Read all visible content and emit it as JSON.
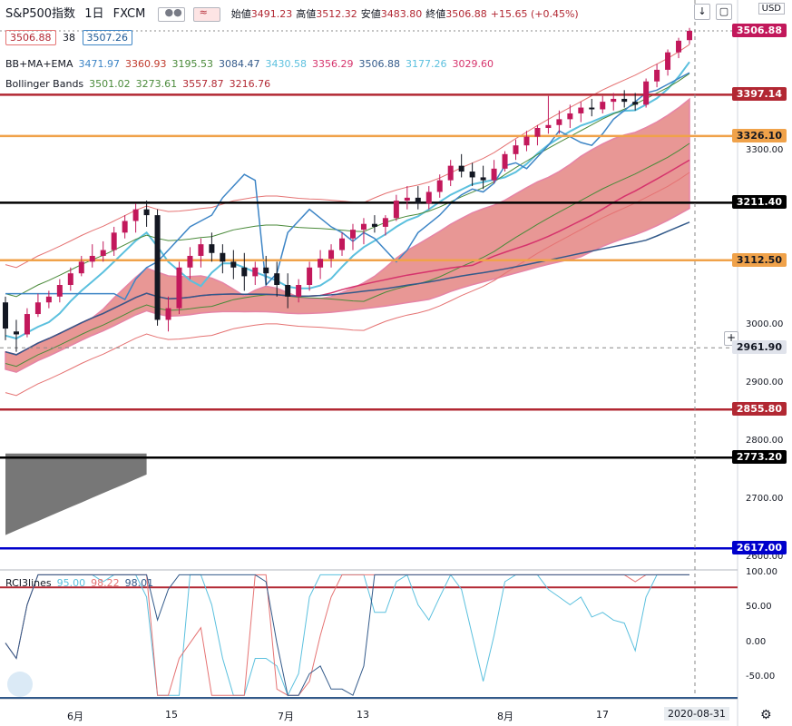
{
  "header": {
    "symbol": "S&P500指数",
    "interval": "1日",
    "source": "FXCM",
    "ohlc": [
      {
        "label": "始値",
        "value": "3491.23"
      },
      {
        "label": "高値",
        "value": "3512.32"
      },
      {
        "label": "安値",
        "value": "3483.80"
      },
      {
        "label": "終値",
        "value": "3506.88"
      }
    ],
    "change": "+15.65 (+0.45%)",
    "bid": "3506.88",
    "spread": "38",
    "ask": "3507.26"
  },
  "indicators": {
    "bbmaema": {
      "label": "BB+MA+EMA",
      "values": [
        {
          "v": "3471.97",
          "color": "#3d85c6"
        },
        {
          "v": "3360.93",
          "color": "#c0392b"
        },
        {
          "v": "3195.53",
          "color": "#4a8a3a"
        },
        {
          "v": "3084.47",
          "color": "#335a8a"
        },
        {
          "v": "3430.58",
          "color": "#5bc0de"
        },
        {
          "v": "3356.29",
          "color": "#d6336c"
        },
        {
          "v": "3506.88",
          "color": "#335a8a"
        },
        {
          "v": "3177.26",
          "color": "#5bc0de"
        },
        {
          "v": "3029.60",
          "color": "#d6336c"
        }
      ]
    },
    "bollinger": {
      "label": "Bollinger Bands",
      "values": [
        {
          "v": "3501.02",
          "color": "#4a8a3a"
        },
        {
          "v": "3273.61",
          "color": "#4a8a3a"
        },
        {
          "v": "3557.87",
          "color": "#b22833"
        },
        {
          "v": "3216.76",
          "color": "#b22833"
        }
      ]
    },
    "rci": {
      "label": "RCI3lines",
      "values": [
        {
          "v": "95.00",
          "color": "#5bc0de"
        },
        {
          "v": "98.22",
          "color": "#e57373"
        },
        {
          "v": "98.01",
          "color": "#335a8a"
        }
      ]
    }
  },
  "price_axis": {
    "currency": "USD",
    "ticks": [
      "3300.00",
      "3000.00",
      "2900.00",
      "2800.00",
      "2700.00",
      "2600.00"
    ],
    "tags": [
      {
        "value": "3506.88",
        "color": "#c2185b",
        "text_color": "#ffffff"
      },
      {
        "value": "3397.14",
        "color": "#b22833",
        "text_color": "#ffffff"
      },
      {
        "value": "3326.10",
        "color": "#f0a24a",
        "text_color": "#131722"
      },
      {
        "value": "3211.40",
        "color": "#000000",
        "text_color": "#ffffff"
      },
      {
        "value": "3112.50",
        "color": "#f0a24a",
        "text_color": "#131722"
      },
      {
        "value": "2961.90",
        "color": "#e0e3eb",
        "text_color": "#131722"
      },
      {
        "value": "2855.80",
        "color": "#b22833",
        "text_color": "#ffffff"
      },
      {
        "value": "2773.20",
        "color": "#000000",
        "text_color": "#ffffff"
      },
      {
        "value": "2617.00",
        "color": "#0000cc",
        "text_color": "#ffffff"
      }
    ]
  },
  "horizontal_lines": [
    {
      "value": 3397.14,
      "color": "#b22833"
    },
    {
      "value": 3326.1,
      "color": "#f0a24a"
    },
    {
      "value": 3211.4,
      "color": "#000000"
    },
    {
      "value": 3112.5,
      "color": "#f0a24a"
    },
    {
      "value": 2855.8,
      "color": "#b22833"
    },
    {
      "value": 2773.2,
      "color": "#000000"
    },
    {
      "value": 2617.0,
      "color": "#0000cc"
    }
  ],
  "rci_axis": {
    "ticks": [
      "100.00",
      "50.00",
      "0.00",
      "-50.00"
    ]
  },
  "time_axis": {
    "labels": [
      "6月",
      "15",
      "7月",
      "13",
      "8月",
      "17"
    ],
    "cursor_date": "2020-08-31"
  },
  "chart_data": {
    "type": "candlestick",
    "series": [
      {
        "name": "S&P500指数",
        "ohlc": [
          [
            3040,
            3050,
            2975,
            2995
          ],
          [
            2990,
            3010,
            2955,
            2985
          ],
          [
            2985,
            3030,
            2980,
            3020
          ],
          [
            3020,
            3055,
            3015,
            3040
          ],
          [
            3040,
            3060,
            3030,
            3050
          ],
          [
            3050,
            3080,
            3040,
            3070
          ],
          [
            3070,
            3100,
            3060,
            3090
          ],
          [
            3090,
            3120,
            3085,
            3110
          ],
          [
            3110,
            3140,
            3100,
            3120
          ],
          [
            3120,
            3145,
            3110,
            3130
          ],
          [
            3130,
            3170,
            3120,
            3160
          ],
          [
            3160,
            3190,
            3150,
            3180
          ],
          [
            3180,
            3210,
            3160,
            3200
          ],
          [
            3200,
            3215,
            3170,
            3190
          ],
          [
            3190,
            3200,
            3000,
            3010
          ],
          [
            3010,
            3050,
            2990,
            3030
          ],
          [
            3030,
            3110,
            3020,
            3100
          ],
          [
            3100,
            3135,
            3080,
            3120
          ],
          [
            3120,
            3150,
            3100,
            3140
          ],
          [
            3140,
            3160,
            3110,
            3125
          ],
          [
            3125,
            3140,
            3090,
            3110
          ],
          [
            3110,
            3130,
            3080,
            3100
          ],
          [
            3100,
            3125,
            3060,
            3085
          ],
          [
            3085,
            3110,
            3070,
            3100
          ],
          [
            3100,
            3120,
            3070,
            3090
          ],
          [
            3090,
            3110,
            3050,
            3070
          ],
          [
            3070,
            3090,
            3030,
            3050
          ],
          [
            3050,
            3080,
            3040,
            3070
          ],
          [
            3070,
            3110,
            3060,
            3100
          ],
          [
            3100,
            3130,
            3080,
            3115
          ],
          [
            3115,
            3140,
            3100,
            3130
          ],
          [
            3130,
            3160,
            3120,
            3150
          ],
          [
            3150,
            3175,
            3130,
            3165
          ],
          [
            3165,
            3185,
            3140,
            3175
          ],
          [
            3175,
            3190,
            3160,
            3170
          ],
          [
            3170,
            3190,
            3155,
            3185
          ],
          [
            3185,
            3225,
            3180,
            3215
          ],
          [
            3215,
            3240,
            3200,
            3220
          ],
          [
            3220,
            3240,
            3200,
            3210
          ],
          [
            3210,
            3240,
            3200,
            3230
          ],
          [
            3230,
            3260,
            3220,
            3250
          ],
          [
            3250,
            3285,
            3240,
            3275
          ],
          [
            3275,
            3295,
            3255,
            3265
          ],
          [
            3265,
            3280,
            3240,
            3255
          ],
          [
            3255,
            3275,
            3235,
            3250
          ],
          [
            3250,
            3285,
            3245,
            3270
          ],
          [
            3270,
            3300,
            3265,
            3295
          ],
          [
            3295,
            3320,
            3285,
            3310
          ],
          [
            3310,
            3335,
            3300,
            3325
          ],
          [
            3325,
            3345,
            3310,
            3340
          ],
          [
            3340,
            3395,
            3330,
            3345
          ],
          [
            3345,
            3370,
            3330,
            3355
          ],
          [
            3355,
            3380,
            3340,
            3365
          ],
          [
            3365,
            3385,
            3350,
            3375
          ],
          [
            3375,
            3390,
            3360,
            3372
          ],
          [
            3372,
            3395,
            3365,
            3385
          ],
          [
            3385,
            3400,
            3370,
            3390
          ],
          [
            3390,
            3405,
            3375,
            3385
          ],
          [
            3385,
            3400,
            3370,
            3380
          ],
          [
            3380,
            3425,
            3375,
            3420
          ],
          [
            3420,
            3450,
            3410,
            3440
          ],
          [
            3440,
            3475,
            3430,
            3470
          ],
          [
            3470,
            3495,
            3460,
            3490
          ],
          [
            3491,
            3512,
            3484,
            3507
          ]
        ]
      }
    ],
    "ylim": [
      2580,
      3560
    ],
    "rci": {
      "ylim": [
        -80,
        105
      ]
    }
  }
}
